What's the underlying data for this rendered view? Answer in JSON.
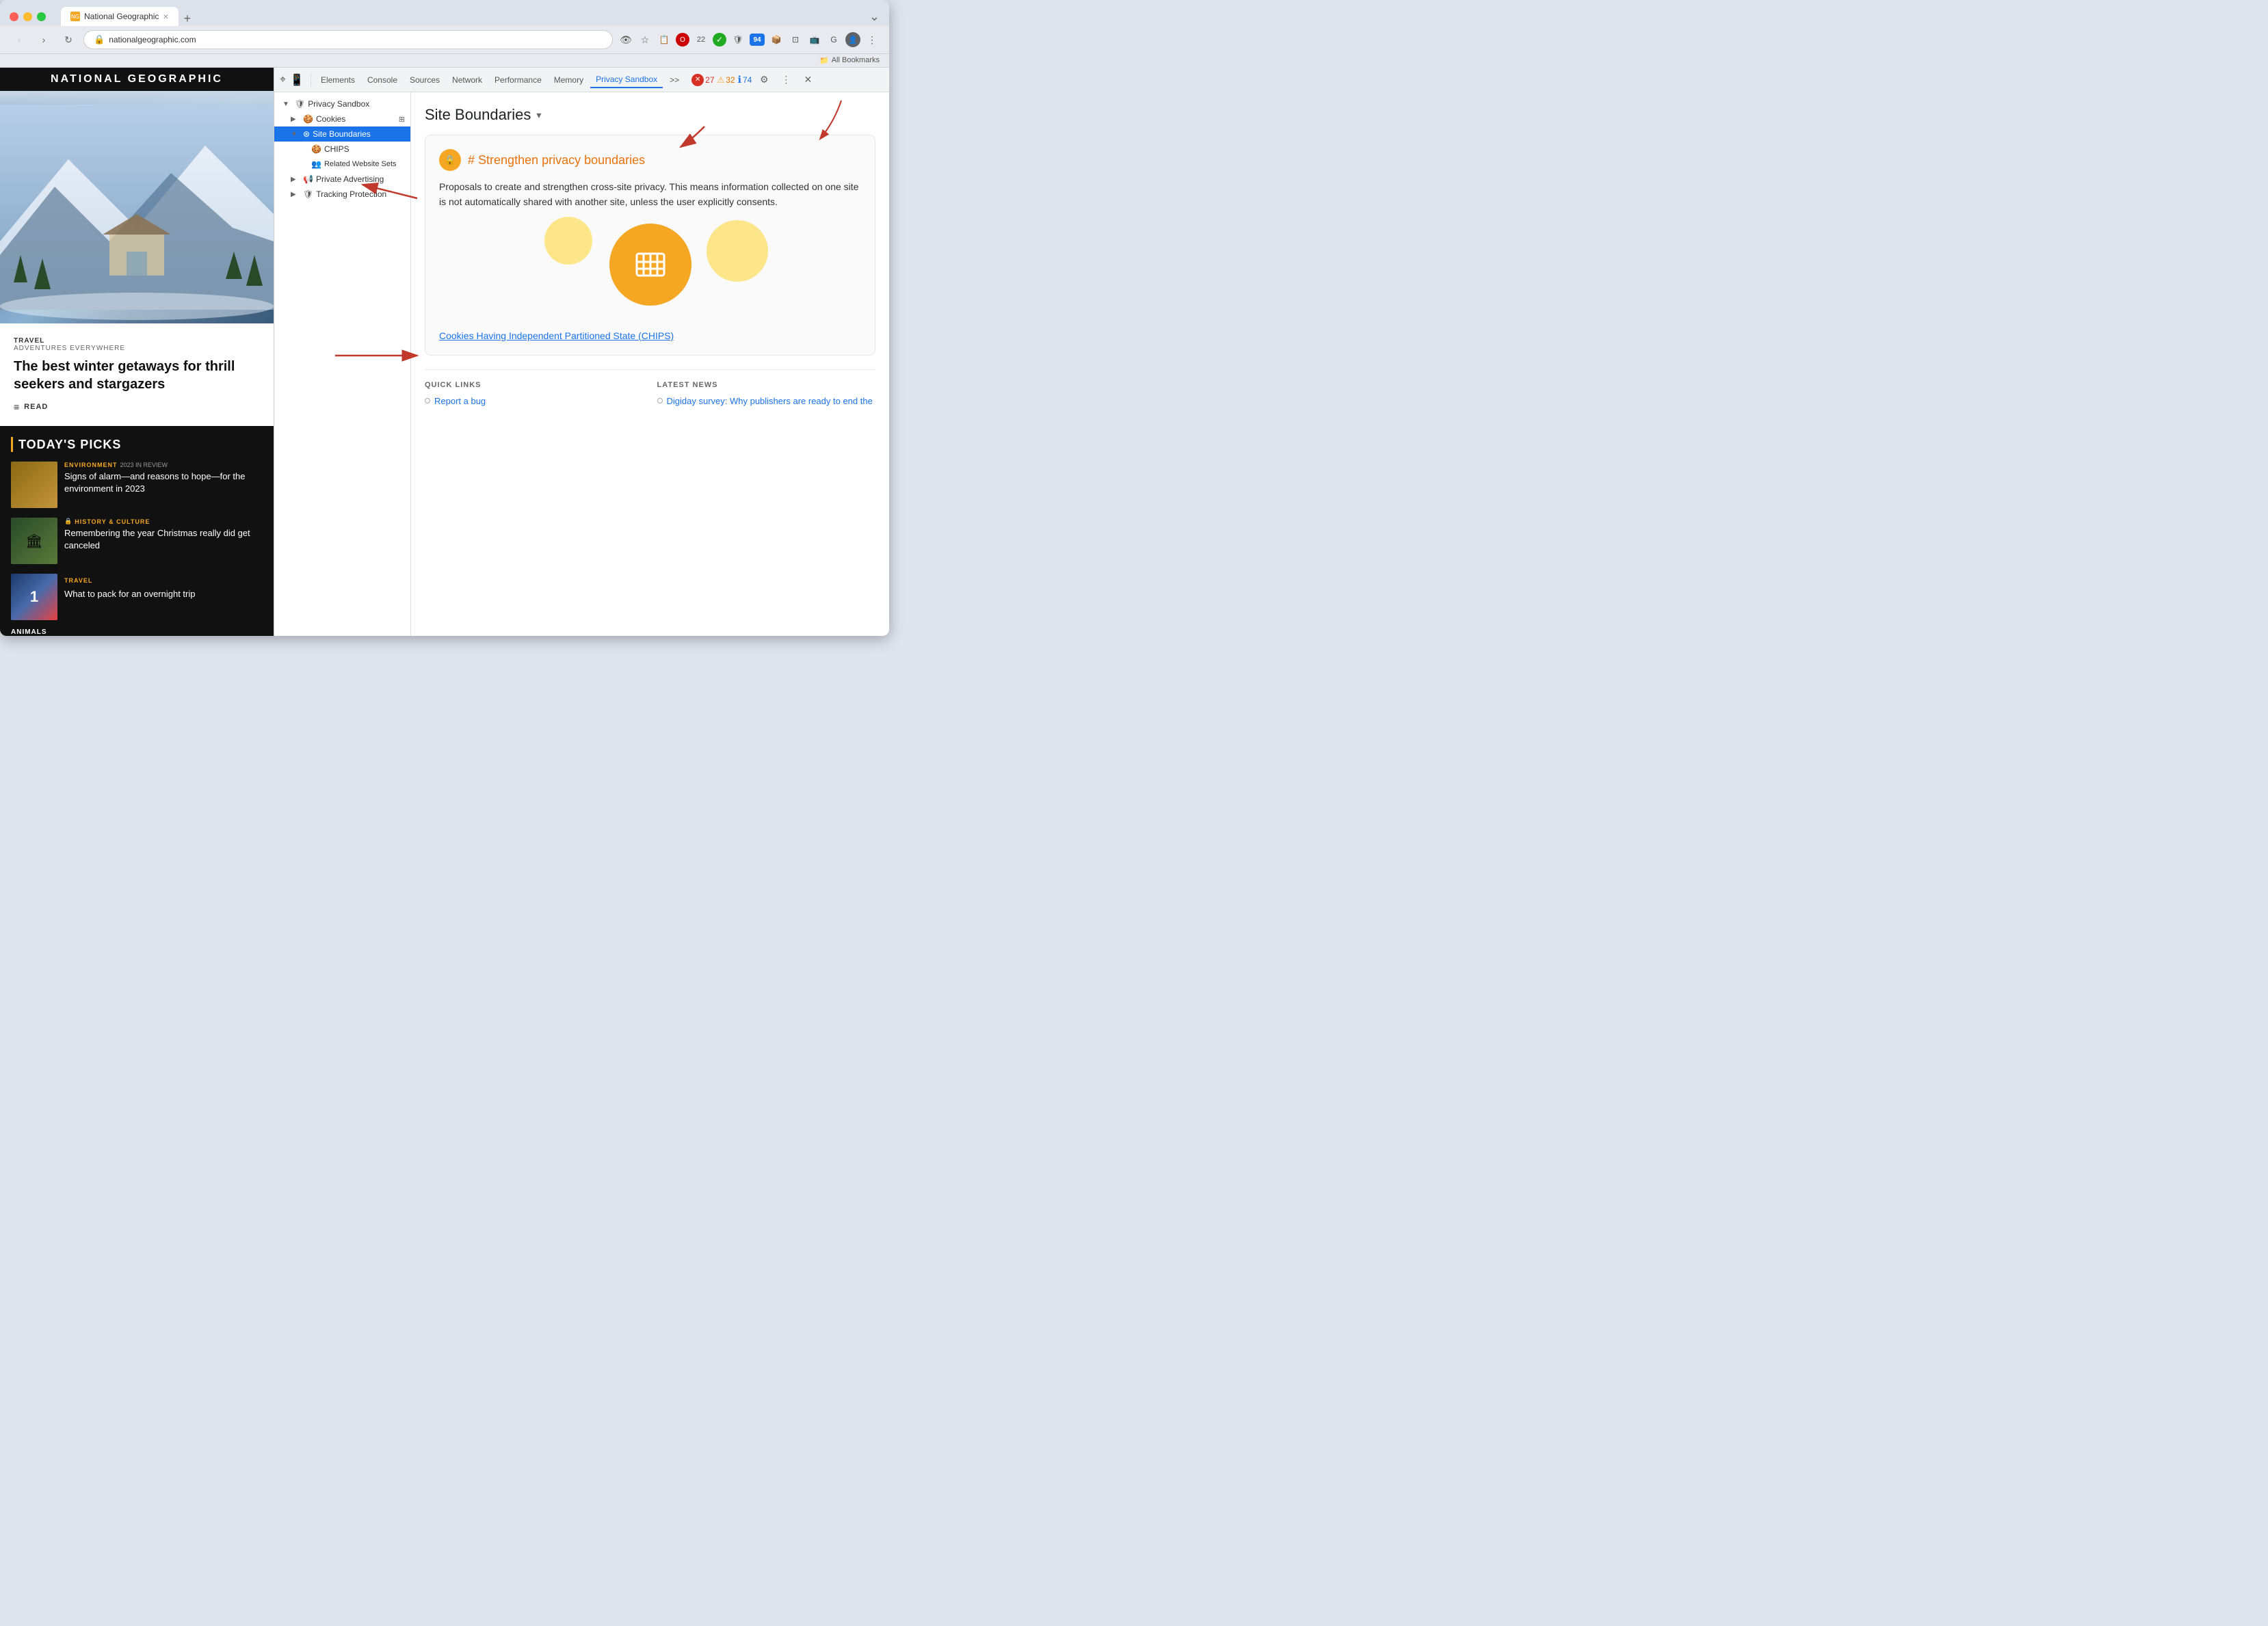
{
  "browser": {
    "tab_title": "National Geographic",
    "tab_favicon": "NG",
    "address": "nationalgeographic.com",
    "bookmarks_label": "All Bookmarks",
    "new_tab_symbol": "+",
    "nav": {
      "back": "‹",
      "forward": "›",
      "reload": "↻"
    }
  },
  "devtools": {
    "tabs": {
      "elements": "Elements",
      "console": "Console",
      "sources": "Sources",
      "network": "Network",
      "performance": "Performance",
      "memory": "Memory",
      "privacy_sandbox": "Privacy Sandbox",
      "more": ">>"
    },
    "badges": {
      "errors": "27",
      "warnings": "32",
      "info": "74"
    },
    "tree": {
      "privacy_sandbox_label": "Privacy Sandbox",
      "cookies_label": "Cookies",
      "site_boundaries_label": "Site Boundaries",
      "chips_label": "CHIPS",
      "related_website_sets_label": "Related Website Sets",
      "private_advertising_label": "Private Advertising",
      "tracking_protection_label": "Tracking Protection"
    },
    "main": {
      "page_title": "Site Boundaries",
      "dropdown_symbol": "▾",
      "card_icon": "🔒",
      "card_title_hash": "#",
      "card_title": "Strengthen privacy boundaries",
      "card_description": "Proposals to create and strengthen cross-site privacy. This means information collected on one site is not automatically shared with another site, unless the user explicitly consents.",
      "chips_link_line1": "Cookies Having Independent Partitioned",
      "chips_link_line2": "State (CHIPS)",
      "quick_links_title": "QUICK LINKS",
      "latest_news_title": "LATEST NEWS",
      "report_bug_link": "Report a bug",
      "latest_news_link": "Digiday survey: Why publishers are ready to end the"
    }
  },
  "webpage": {
    "logo": "National Geographic",
    "hero_article": {
      "category": "TRAVEL",
      "subtitle": "ADVENTURES EVERYWHERE",
      "title": "The best winter getaways for thrill seekers and stargazers",
      "read_label": "READ"
    },
    "section_title": "TODAY'S PICKS",
    "picks": [
      {
        "category": "ENVIRONMENT",
        "category_sub": "2023 IN REVIEW",
        "title": "Signs of alarm—and reasons to hope—for the environment in 2023",
        "thumb_class": "pick-thumb-env"
      },
      {
        "category": "HISTORY & CULTURE",
        "category_sub": "",
        "title": "Remembering the year Christmas really did get canceled",
        "thumb_class": "pick-thumb-hist"
      },
      {
        "category": "TRAVEL",
        "category_sub": "",
        "title": "What to pack for an overnight trip",
        "thumb_class": "pick-thumb-travel"
      }
    ],
    "animals_label": "ANIMALS"
  }
}
